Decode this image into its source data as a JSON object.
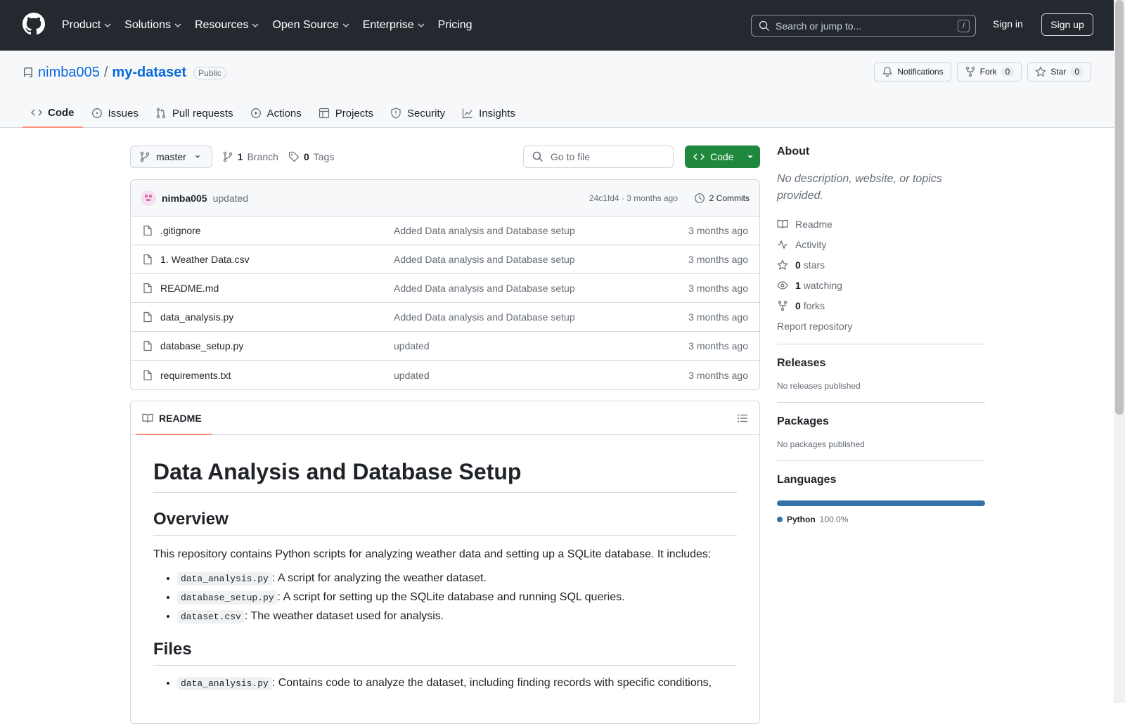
{
  "nav": {
    "items": [
      "Product",
      "Solutions",
      "Resources",
      "Open Source",
      "Enterprise",
      "Pricing"
    ],
    "search_placeholder": "Search or jump to...",
    "slash": "/",
    "signin": "Sign in",
    "signup": "Sign up"
  },
  "repo": {
    "owner": "nimba005",
    "sep": "/",
    "name": "my-dataset",
    "visibility": "Public",
    "notifications": "Notifications",
    "fork": "Fork",
    "fork_count": "0",
    "star": "Star",
    "star_count": "0",
    "tabs": [
      "Code",
      "Issues",
      "Pull requests",
      "Actions",
      "Projects",
      "Security",
      "Insights"
    ]
  },
  "toolbar": {
    "branch": "master",
    "branch_count": "1",
    "branch_label": "Branch",
    "tag_count": "0",
    "tag_label": "Tags",
    "goto_file": "Go to file",
    "code": "Code"
  },
  "commit": {
    "author": "nimba005",
    "message": "updated",
    "sha_time": "24c1fd4 · 3 months ago",
    "commits": "2 Commits"
  },
  "files": [
    {
      "name": ".gitignore",
      "msg": "Added Data analysis and Database setup",
      "date": "3 months ago"
    },
    {
      "name": "1. Weather Data.csv",
      "msg": "Added Data analysis and Database setup",
      "date": "3 months ago"
    },
    {
      "name": "README.md",
      "msg": "Added Data analysis and Database setup",
      "date": "3 months ago"
    },
    {
      "name": "data_analysis.py",
      "msg": "Added Data analysis and Database setup",
      "date": "3 months ago"
    },
    {
      "name": "database_setup.py",
      "msg": "updated",
      "date": "3 months ago"
    },
    {
      "name": "requirements.txt",
      "msg": "updated",
      "date": "3 months ago"
    }
  ],
  "readme": {
    "tab": "README",
    "h1": "Data Analysis and Database Setup",
    "h2_overview": "Overview",
    "intro": "This repository contains Python scripts for analyzing weather data and setting up a SQLite database. It includes:",
    "items": [
      {
        "code": "data_analysis.py",
        "text": ": A script for analyzing the weather dataset."
      },
      {
        "code": "database_setup.py",
        "text": ": A script for setting up the SQLite database and running SQL queries."
      },
      {
        "code": "dataset.csv",
        "text": ": The weather dataset used for analysis."
      }
    ],
    "h2_files": "Files",
    "files_items": [
      {
        "code": "data_analysis.py",
        "text": ": Contains code to analyze the dataset, including finding records with specific conditions,"
      }
    ]
  },
  "about": {
    "title": "About",
    "desc": "No description, website, or topics provided.",
    "readme": "Readme",
    "activity": "Activity",
    "stars_n": "0",
    "stars": "stars",
    "watch_n": "1",
    "watch": "watching",
    "forks_n": "0",
    "forks": "forks",
    "report": "Report repository"
  },
  "releases": {
    "title": "Releases",
    "text": "No releases published"
  },
  "packages": {
    "title": "Packages",
    "text": "No packages published"
  },
  "languages": {
    "title": "Languages",
    "name": "Python",
    "pct": "100.0%",
    "value": 100,
    "color": "#3572a5"
  }
}
